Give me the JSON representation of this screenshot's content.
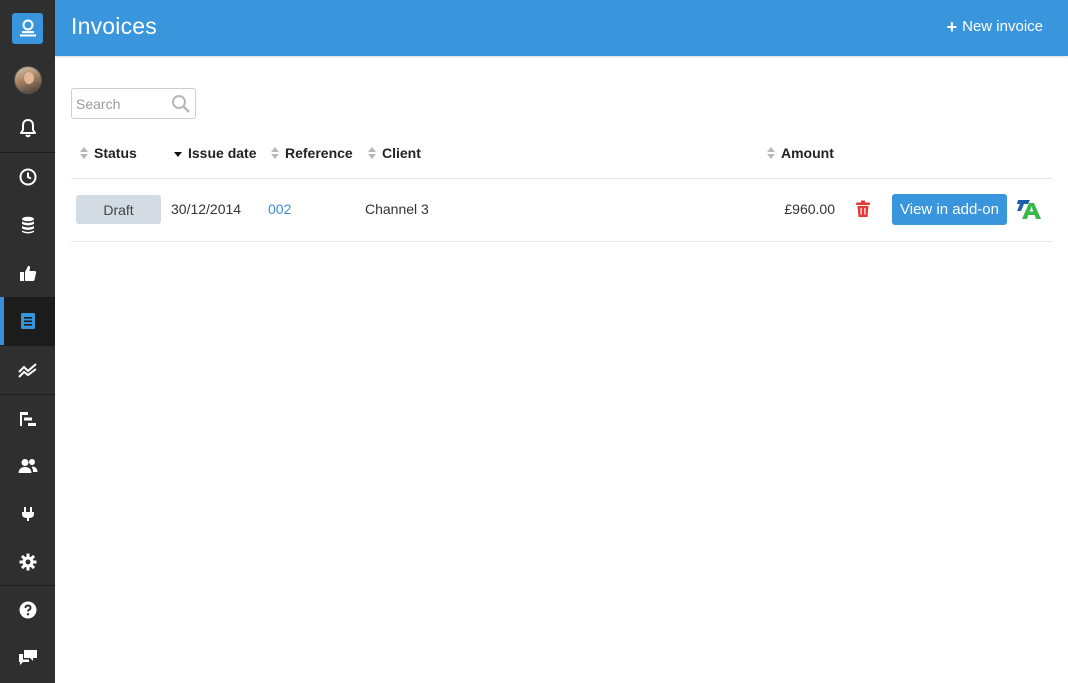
{
  "header": {
    "title": "Invoices",
    "new_invoice_label": "New invoice",
    "accent_color": "#3a96dc"
  },
  "sidebar": {
    "items": [
      {
        "name": "logo-icon"
      },
      {
        "name": "avatar"
      },
      {
        "name": "bell-icon"
      },
      {
        "name": "clock-icon"
      },
      {
        "name": "database-icon"
      },
      {
        "name": "thumbs-up-icon"
      },
      {
        "name": "invoice-icon",
        "active": true
      },
      {
        "name": "chart-line-icon"
      },
      {
        "name": "gantt-icon"
      },
      {
        "name": "users-icon"
      },
      {
        "name": "plug-icon"
      },
      {
        "name": "gear-icon"
      },
      {
        "name": "help-icon"
      },
      {
        "name": "chat-icon"
      }
    ]
  },
  "search": {
    "placeholder": "Search",
    "value": ""
  },
  "table": {
    "columns": {
      "status": "Status",
      "issue_date": "Issue date",
      "reference": "Reference",
      "client": "Client",
      "amount": "Amount"
    },
    "sorted_column": "issue_date",
    "rows": [
      {
        "status": "Draft",
        "issue_date": "30/12/2014",
        "reference": "002",
        "client": "Channel 3",
        "amount": "£960.00",
        "action_label": "View in add-on"
      }
    ]
  },
  "colors": {
    "sidebar_bg": "#2f2f2f",
    "delete_icon": "#e53935",
    "status_draft_bg": "#d3dce3",
    "link": "#3a8fd8"
  }
}
